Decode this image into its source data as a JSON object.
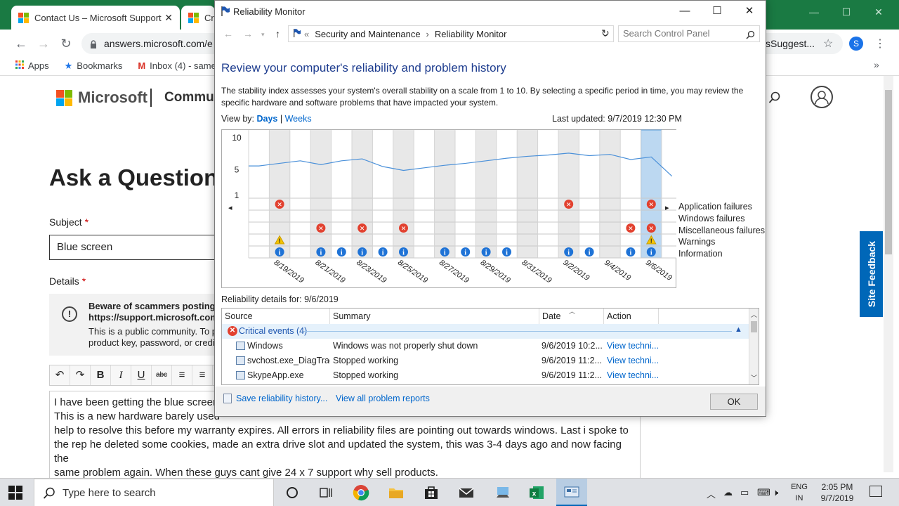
{
  "browser": {
    "tabs": [
      {
        "label": "Contact Us – Microsoft Support"
      },
      {
        "label": "Cr"
      }
    ],
    "url": "answers.microsoft.com/e",
    "url_tail": "sSuggest...",
    "avatar_letter": "S",
    "bookmarks": [
      {
        "label": "Apps"
      },
      {
        "label": "Bookmarks"
      },
      {
        "label": "Inbox (4) - samee"
      }
    ]
  },
  "page": {
    "brand": "Microsoft",
    "community": "Commun",
    "title": "Ask a Question",
    "subject_label": "Subject",
    "subject_value": "Blue screen",
    "details_label": "Details",
    "required_mark": "*",
    "warning_title": "Beware of scammers posting f",
    "warning_link": "https://support.microsoft.com",
    "warning_body_1": "This is a public community. To p",
    "warning_body_2": "product key, password, or credi",
    "editor_buttons": [
      "↶",
      "↷",
      "B",
      "I",
      "U",
      "abc",
      "≡",
      "≡"
    ],
    "editor_text": "I have been getting the blue screen ... This is a new hardware barely used ... help to resolve this before my warranty expires. All errors in reliability files are pointing out towards windows. Last i spoke to the rep he deleted some cookies, made an extra drive slot and updated the system, this was 3-4 days ago and now facing the same problem again. When these guys cant give 24 x 7 support why sell products.",
    "editor_lines": [
      "I have been getting the blue screen",
      "This is a new hardware barely used",
      "help to resolve this before my warranty expires. All errors in reliability files are pointing out towards windows. Last i spoke to",
      "the rep he deleted some cookies, made an extra drive slot and updated the system, this was 3-4 days ago and now facing the",
      "same problem again. When these guys cant give 24 x 7 support why sell products."
    ],
    "site_feedback": "Site Feedback"
  },
  "reliability_monitor": {
    "window_title": "Reliability Monitor",
    "breadcrumb": [
      "Security and Maintenance",
      "Reliability Monitor"
    ],
    "search_placeholder": "Search Control Panel",
    "heading": "Review your computer's reliability and problem history",
    "description": "The stability index assesses your system's overall stability on a scale from 1 to 10. By selecting a specific period in time, you may review the specific hardware and software problems that have impacted your system.",
    "view_by_label": "View by:",
    "view_days": "Days",
    "view_sep": "|",
    "view_weeks": "Weeks",
    "last_updated": "Last updated: 9/7/2019 12:30 PM",
    "legend": [
      "Application failures",
      "Windows failures",
      "Miscellaneous failures",
      "Warnings",
      "Information"
    ],
    "details_for": "Reliability details for: 9/6/2019",
    "table": {
      "headers": [
        "Source",
        "Summary",
        "Date",
        "Action"
      ],
      "group": "Critical events (4)",
      "rows": [
        {
          "source": "Windows",
          "summary": "Windows was not properly shut down",
          "date": "9/6/2019 10:2...",
          "action": "View techni..."
        },
        {
          "source": "svchost.exe_DiagTrack",
          "summary": "Stopped working",
          "date": "9/6/2019 11:2...",
          "action": "View techni..."
        },
        {
          "source": "SkypeApp.exe",
          "summary": "Stopped working",
          "date": "9/6/2019 11:2...",
          "action": "View techni..."
        }
      ]
    },
    "footer_save": "Save reliability history...",
    "footer_view_all": "View all problem reports",
    "ok": "OK"
  },
  "chart_data": {
    "type": "line",
    "title": "",
    "y_ticks": [
      "10",
      "5",
      "1"
    ],
    "ylim": [
      1,
      10
    ],
    "x_labels": [
      "8/19/2019",
      "8/21/2019",
      "8/23/2019",
      "8/25/2019",
      "8/27/2019",
      "8/29/2019",
      "8/31/2019",
      "9/2/2019",
      "9/4/2019",
      "9/6/2019"
    ],
    "days": [
      "8/18",
      "8/19",
      "8/20",
      "8/21",
      "8/22",
      "8/23",
      "8/24",
      "8/25",
      "8/26",
      "8/27",
      "8/28",
      "8/29",
      "8/30",
      "8/31",
      "9/1",
      "9/2",
      "9/3",
      "9/4",
      "9/5",
      "9/6",
      "9/7"
    ],
    "stability_index": [
      5.6,
      6.0,
      6.4,
      5.8,
      6.4,
      6.7,
      5.5,
      4.9,
      5.3,
      5.7,
      6.0,
      6.4,
      6.8,
      7.1,
      7.3,
      7.6,
      7.2,
      7.4,
      6.6,
      7.0,
      4.0
    ],
    "selected_day": "9/6",
    "events": {
      "application_failures": [
        "8/19",
        "9/2",
        "9/6"
      ],
      "windows_failures": [],
      "miscellaneous_failures": [
        "8/21",
        "8/23",
        "8/25",
        "9/5",
        "9/6"
      ],
      "warnings": [
        "8/19",
        "9/6"
      ],
      "information": [
        "8/19",
        "8/21",
        "8/22",
        "8/23",
        "8/24",
        "8/25",
        "8/27",
        "8/28",
        "8/29",
        "8/30",
        "9/2",
        "9/3",
        "9/5",
        "9/6"
      ]
    }
  },
  "taskbar": {
    "search_placeholder": "Type here to search",
    "lang_1": "ENG",
    "lang_2": "IN",
    "time": "2:05 PM",
    "date": "9/7/2019"
  }
}
